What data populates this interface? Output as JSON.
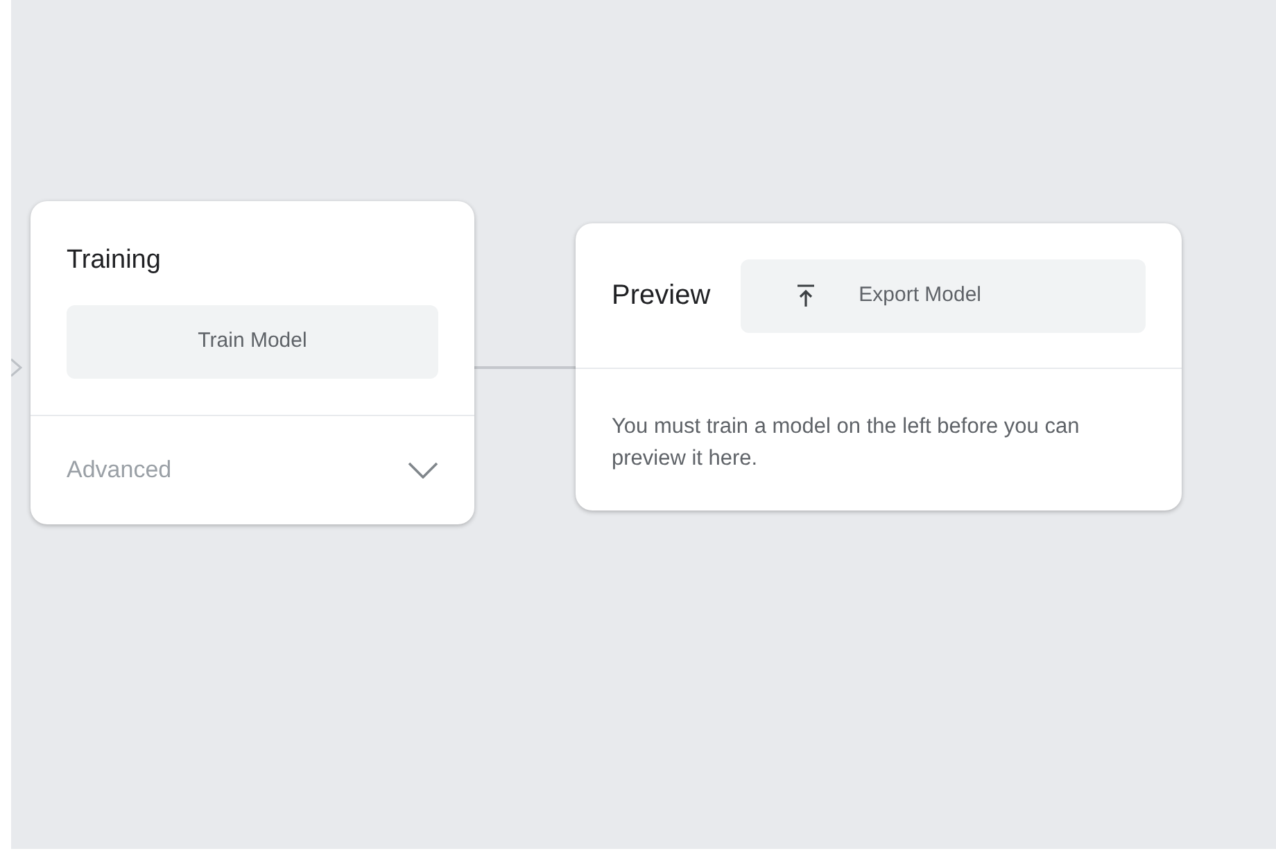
{
  "training_card": {
    "title": "Training",
    "button": "Train Model",
    "advanced": {
      "label": "Advanced",
      "expanded": false
    }
  },
  "preview_card": {
    "title": "Preview",
    "button": "Export Model",
    "message": "You must train a model on the left before you can preview it here."
  }
}
